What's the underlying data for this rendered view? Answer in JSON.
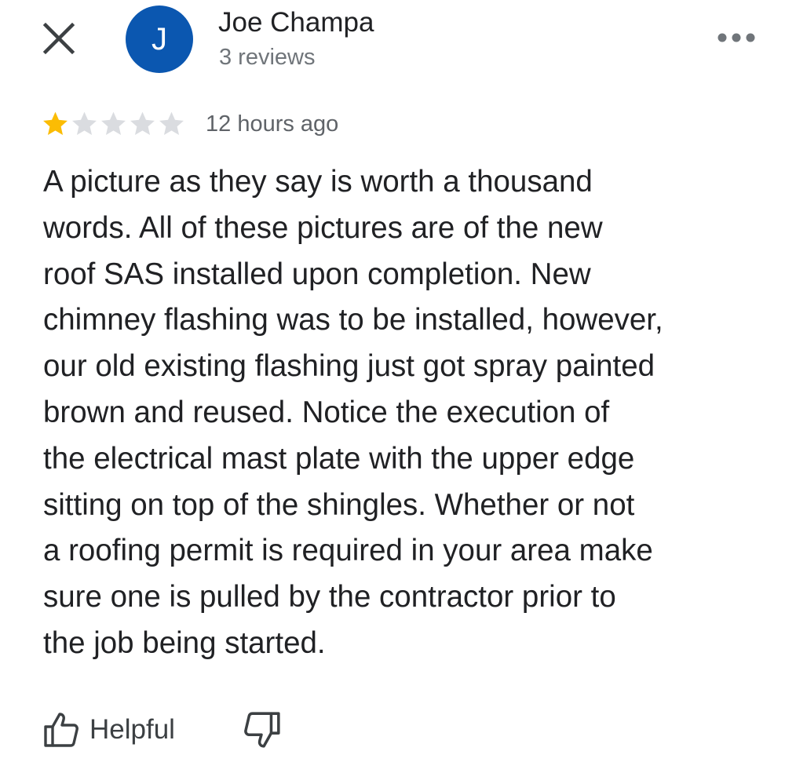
{
  "header": {
    "close_icon": "close-icon",
    "avatar_letter": "J",
    "avatar_color": "#0b57b0",
    "reviewer_name": "Joe Champa",
    "review_count": "3 reviews",
    "more_icon": "more-options-icon"
  },
  "rating": {
    "stars_filled": 1,
    "stars_total": 5,
    "filled_color": "#fbbc04",
    "empty_color": "#dadce0",
    "time_ago": "12 hours ago"
  },
  "review": {
    "text": "A picture as they say is worth a thousand\nwords.  All of these pictures  are of the new\nroof SAS installed upon completion.  New\nchimney flashing was to be installed, however,\nour old existing flashing just got spray painted\nbrown and reused.  Notice the execution of\nthe electrical mast plate with the upper edge\nsitting on top of the shingles.  Whether or not\na roofing permit is required in your area make\nsure one is pulled by the contractor prior to\nthe job being started."
  },
  "actions": {
    "helpful_label": "Helpful",
    "helpful_icon": "thumbs-up-icon",
    "dislike_icon": "thumbs-down-icon"
  }
}
